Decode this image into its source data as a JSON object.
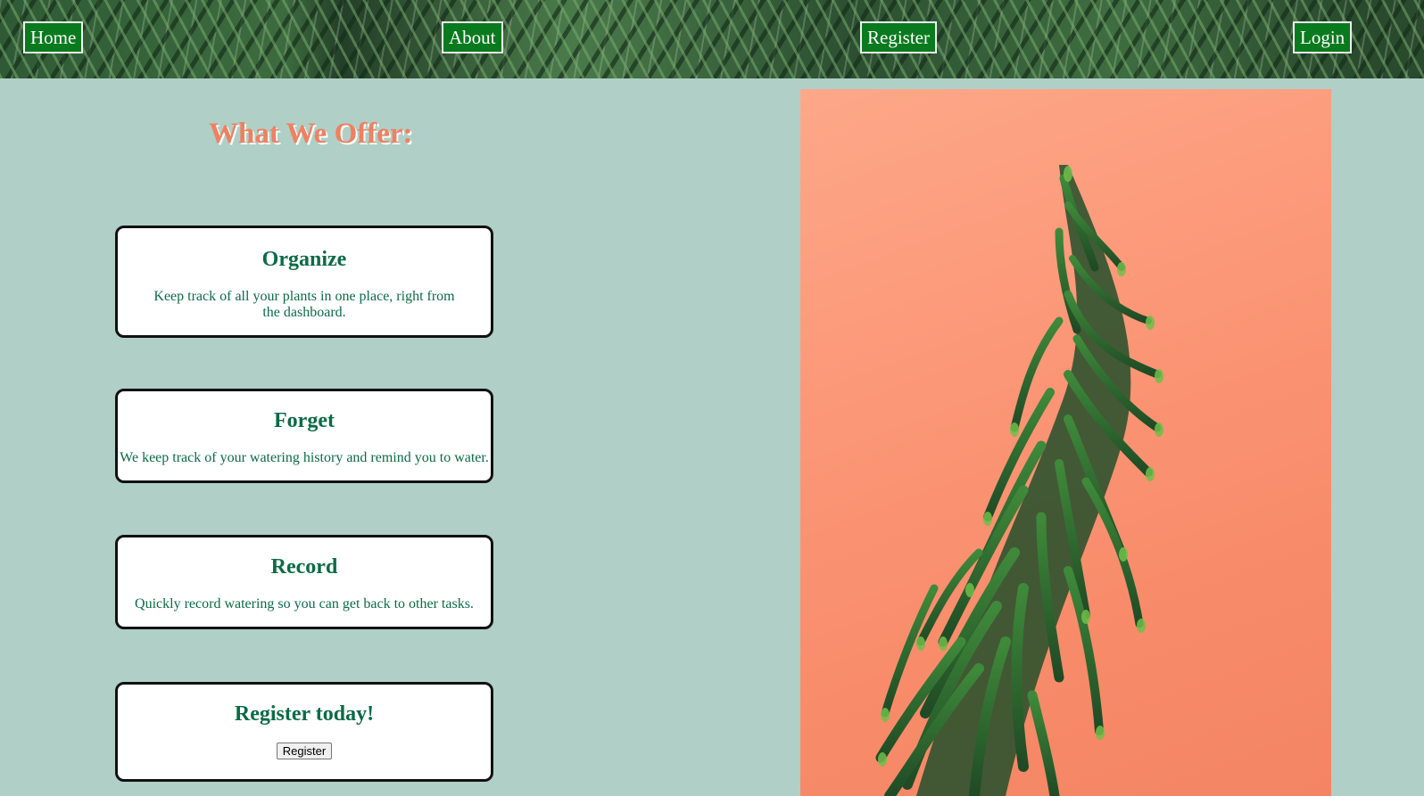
{
  "nav": {
    "home": "Home",
    "about": "About",
    "register": "Register",
    "login": "Login"
  },
  "main": {
    "heading": "What We Offer:",
    "cards": [
      {
        "title": "Organize",
        "text": "Keep track of all your plants in one place, right from the dashboard."
      },
      {
        "title": "Forget",
        "text": "We keep track of your watering history and remind you to water."
      },
      {
        "title": "Record",
        "text": "Quickly record watering so you can get back to other tasks."
      },
      {
        "title": "Register today!",
        "button": "Register"
      }
    ]
  },
  "colors": {
    "background": "#b0cfc6",
    "nav_button": "#0a7a1e",
    "heading": "#f08060",
    "card_text": "#0b6b47",
    "image_background": "#fb9676"
  },
  "image": {
    "subject": "plant-photo"
  }
}
